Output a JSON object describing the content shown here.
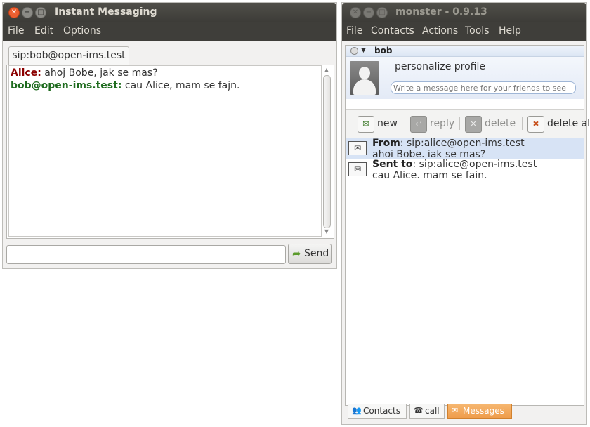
{
  "im_window": {
    "title": "Instant Messaging",
    "menu": [
      "File",
      "Edit",
      "Options"
    ],
    "tab_label": "sip:bob@open-ims.test",
    "messages": [
      {
        "sender": "Alice:",
        "text": " ahoj Bobe, jak se mas?"
      },
      {
        "sender": "bob@open-ims.test:",
        "text": " cau Alice, mam se fajn."
      }
    ],
    "input_value": "",
    "send_label": "Send"
  },
  "monster_window": {
    "title": "monster - 0.9.13",
    "menu": [
      "File",
      "Contacts",
      "Actions",
      "Tools",
      "Help"
    ],
    "user_name": "bob",
    "personalize_label": "personalize profile",
    "status_placeholder": "Write a message here for your friends to see",
    "toolbar": {
      "new": "new",
      "reply": "reply",
      "delete": "delete",
      "delete_all": "delete all"
    },
    "messages": [
      {
        "label": "From",
        "addr": ": sip:alice@open-ims.test",
        "text": "ahoj Bobe, jak se mas?"
      },
      {
        "label": "Sent to",
        "addr": ": sip:alice@open-ims.test",
        "text": "cau Alice, mam se fajn."
      }
    ],
    "tabs": {
      "contacts": "Contacts",
      "call": "call",
      "messages": "Messages"
    }
  },
  "colors": {
    "alice": "#8b0000",
    "bob": "#1e6b1e",
    "titlebar": "#3f3e3a",
    "active_tab": "#ef9d4c",
    "selected_row": "#d7e3f5"
  },
  "icons": [
    "close-icon",
    "minimize-icon",
    "maximize-icon",
    "send-icon",
    "avatar-icon",
    "new-message-icon",
    "reply-icon",
    "delete-icon",
    "delete-all-icon",
    "received-envelope-icon",
    "sent-envelope-icon",
    "contacts-icon",
    "phone-icon",
    "messages-icon"
  ]
}
